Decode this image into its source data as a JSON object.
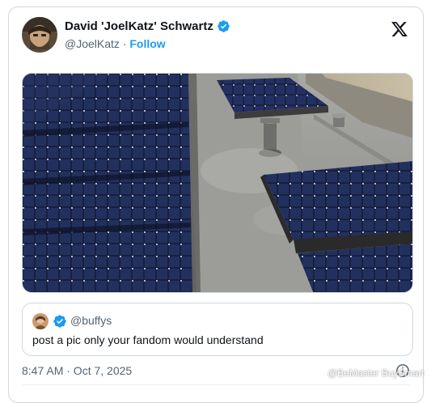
{
  "tweet": {
    "author_name": "David 'JoelKatz' Schwartz",
    "handle": "@JoelKatz",
    "separator": "·",
    "follow_label": "Follow",
    "timestamp": "8:47 AM · Oct 7, 2025",
    "verified_color": "#1d9bf0"
  },
  "quoted_tweet": {
    "handle": "@buffys",
    "text": "post a pic only your fandom would understand"
  },
  "icons": {
    "brand": "x-logo-icon",
    "verified": "verified-badge-icon",
    "info": "info-icon"
  },
  "watermark": "@BeMaster BuySmart"
}
